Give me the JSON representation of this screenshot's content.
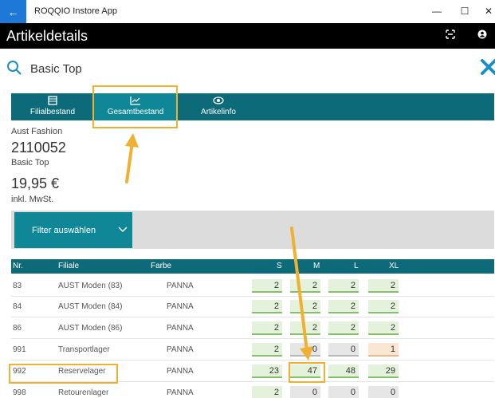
{
  "window": {
    "app_title": "ROQQIO Instore App",
    "back_glyph": "←",
    "minimize_glyph": "—",
    "maximize_glyph": "☐",
    "close_glyph": "✕"
  },
  "header": {
    "title": "Artikeldetails"
  },
  "search": {
    "value": "Basic Top"
  },
  "tabs": [
    {
      "label": "Filialbestand",
      "icon": "store-icon"
    },
    {
      "label": "Gesamtbestand",
      "icon": "chart-icon",
      "active": true
    },
    {
      "label": "Artikelinfo",
      "icon": "eye-icon"
    }
  ],
  "product": {
    "brand": "Aust Fashion",
    "article_number": "2110052",
    "name": "Basic Top",
    "price": "19,95 €",
    "vat_note": "inkl. MwSt."
  },
  "filter": {
    "label": "Filter auswählen"
  },
  "table": {
    "headers": {
      "nr": "Nr.",
      "filiale": "Filiale",
      "farbe": "Farbe",
      "s": "S",
      "m": "M",
      "l": "L",
      "xl": "XL"
    },
    "rows": [
      {
        "nr": "83",
        "filiale": "AUST Moden (83)",
        "farbe": "PANNA",
        "s": "2",
        "m": "2",
        "l": "2",
        "xl": "2"
      },
      {
        "nr": "84",
        "filiale": "AUST Moden (84)",
        "farbe": "PANNA",
        "s": "2",
        "m": "2",
        "l": "2",
        "xl": "2"
      },
      {
        "nr": "86",
        "filiale": "AUST Moden (86)",
        "farbe": "PANNA",
        "s": "2",
        "m": "2",
        "l": "2",
        "xl": "2"
      },
      {
        "nr": "991",
        "filiale": "Transportlager",
        "farbe": "PANNA",
        "s": "2",
        "m": "0",
        "l": "0",
        "xl": "1"
      },
      {
        "nr": "992",
        "filiale": "Reservelager",
        "farbe": "PANNA",
        "s": "23",
        "m": "47",
        "l": "48",
        "xl": "29"
      },
      {
        "nr": "998",
        "filiale": "Retourenlager",
        "farbe": "PANNA",
        "s": "2",
        "m": "0",
        "l": "0",
        "xl": "0"
      }
    ]
  },
  "colors": {
    "header_bg": "#000000",
    "tabbar_bg": "#0d6a78",
    "accent_teal": "#0f8796",
    "highlight_orange": "#f0b030",
    "stock_green": "#e4f2dc",
    "stock_zero_grey": "#e6e6e6",
    "stock_low_peach": "#fbe5d3"
  }
}
